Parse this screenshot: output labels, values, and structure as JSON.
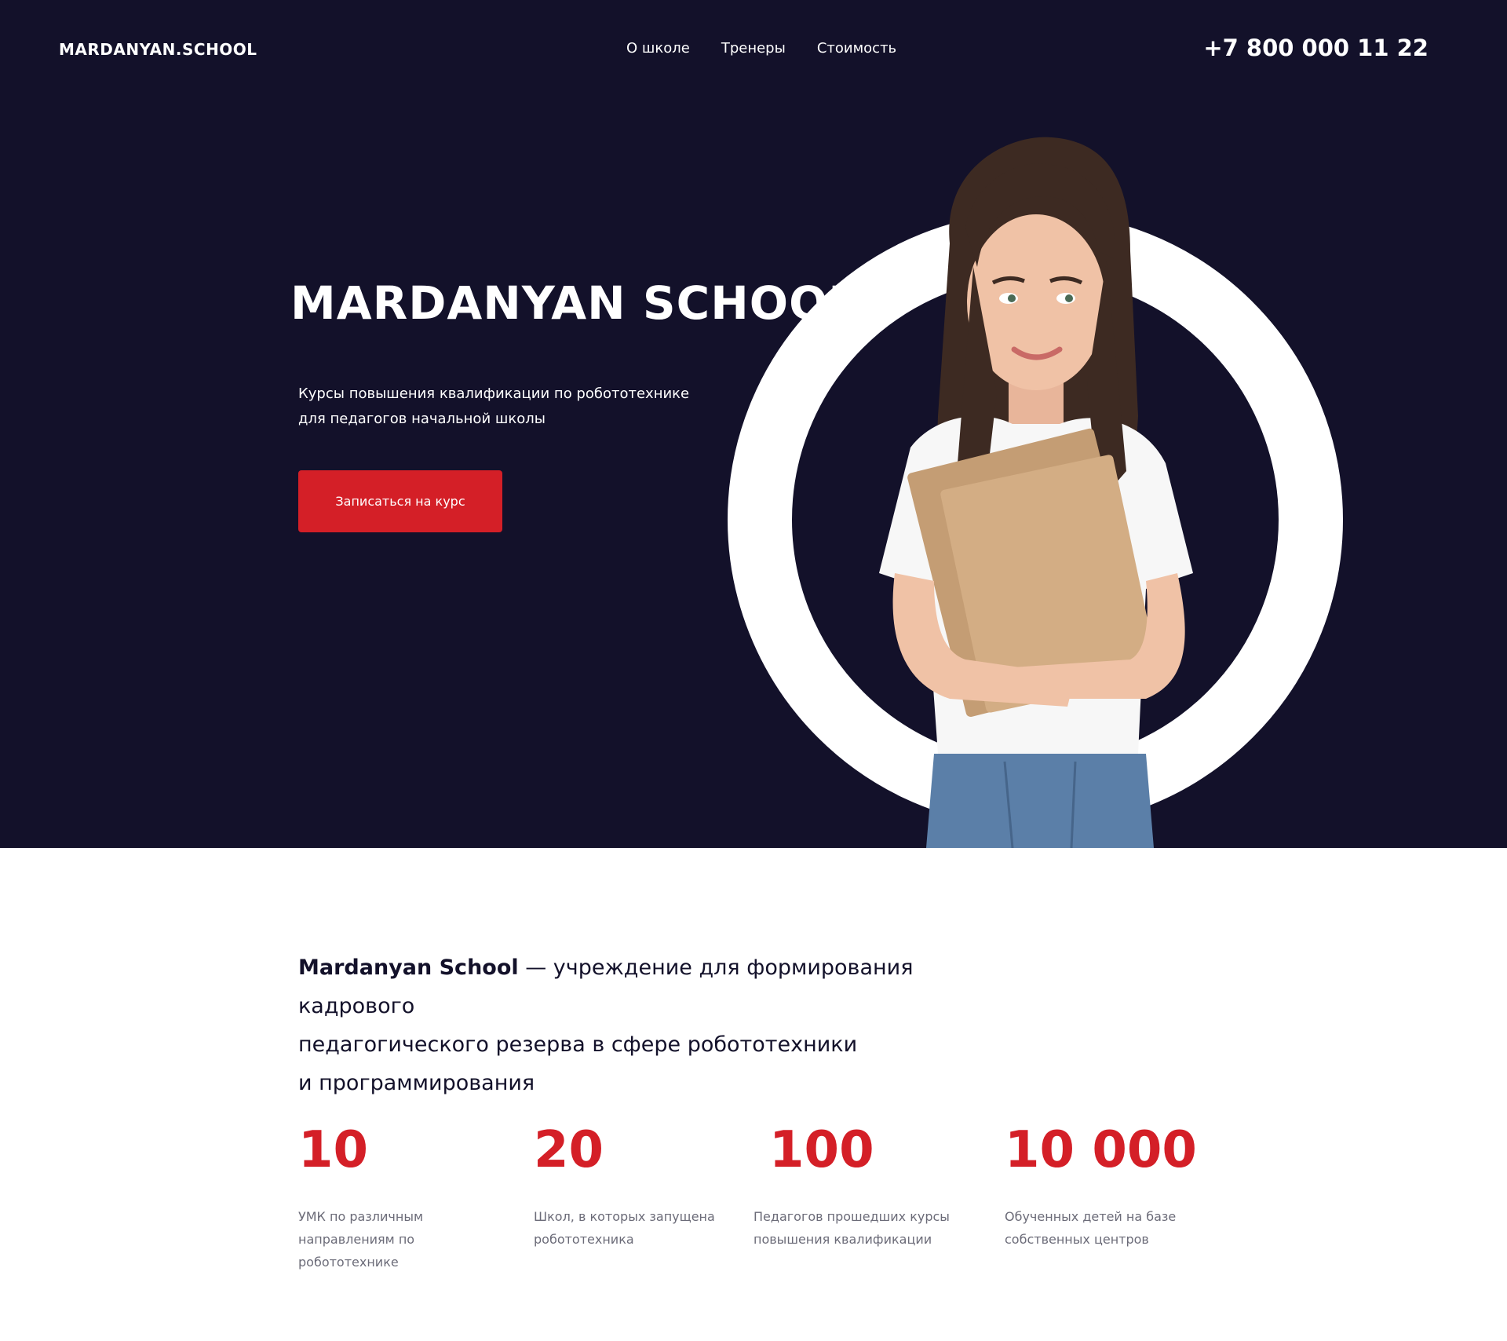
{
  "header": {
    "logo": "MARDANYAN.SCHOOL",
    "nav": [
      "О школе",
      "Тренеры",
      "Стоимость"
    ],
    "phone": "+7 800 000 11 22"
  },
  "hero": {
    "title": "MARDANYAN SCHOOL",
    "subtitle_line1": "Курсы повышения квалификации по робототехнике",
    "subtitle_line2": "для педагогов начальной школы",
    "cta": "Записаться на курс"
  },
  "about": {
    "brand": "Mardanyan School",
    "text_line1": " — учреждение для формирования кадрового",
    "text_line2": "педагогического резерва в сфере робототехники",
    "text_line3": "и программирования"
  },
  "stats": [
    {
      "number": "10",
      "label_line1": "УМК по различным",
      "label_line2": "направлениям по робототехнике"
    },
    {
      "number": "20",
      "label_line1": "Школ, в которых запущена",
      "label_line2": "робототехника"
    },
    {
      "number": "100",
      "label_line1": "Педагогов прошедших курсы",
      "label_line2": "повышения квалификации"
    },
    {
      "number": "10 000",
      "label_line1": "Обученных детей на базе",
      "label_line2": "собственных центров"
    }
  ],
  "colors": {
    "hero_bg": "#13112a",
    "accent": "#d41f27",
    "text_dark": "#13112a",
    "text_muted": "#6b6b78"
  }
}
